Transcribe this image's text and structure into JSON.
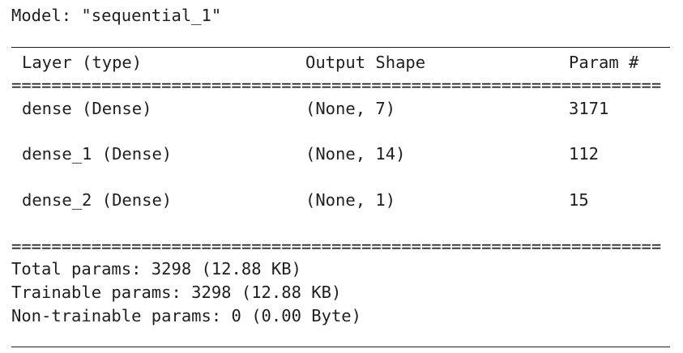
{
  "model_title": "Model: \"sequential_1\"",
  "headers": {
    "layer": "Layer (type)",
    "output": "Output Shape",
    "params": "Param #"
  },
  "separator": "=================================================================",
  "rows": [
    {
      "layer": "dense (Dense)",
      "output": "(None, 7)",
      "params": "3171"
    },
    {
      "layer": "dense_1 (Dense)",
      "output": "(None, 14)",
      "params": "112"
    },
    {
      "layer": "dense_2 (Dense)",
      "output": "(None, 1)",
      "params": "15"
    }
  ],
  "summary": {
    "total": "Total params: 3298 (12.88 KB)",
    "trainable": "Trainable params: 3298 (12.88 KB)",
    "non_trainable": "Non-trainable params: 0 (0.00 Byte)"
  }
}
